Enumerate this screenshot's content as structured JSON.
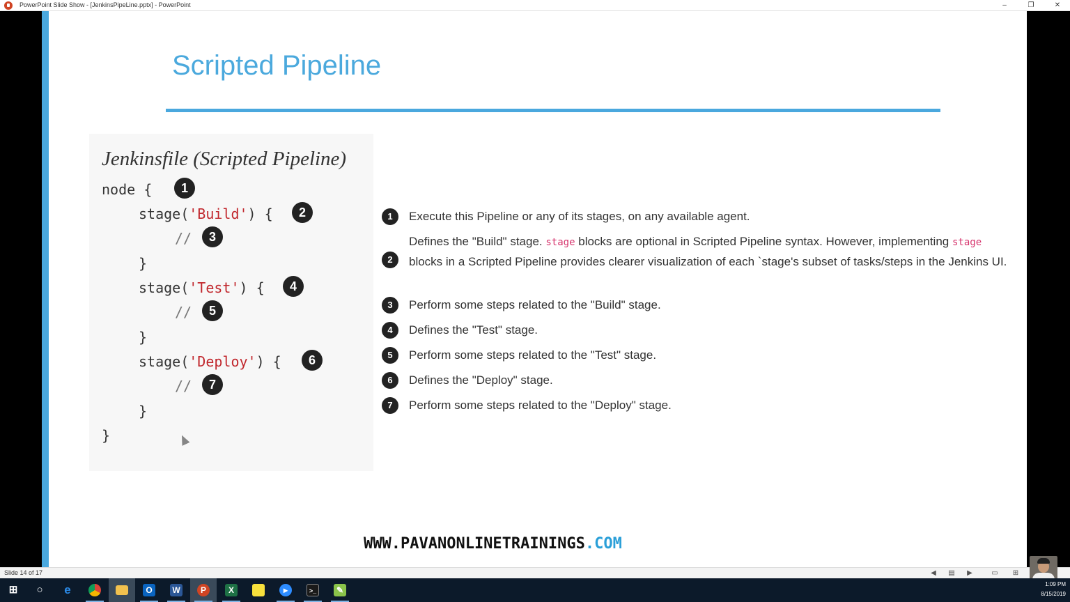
{
  "window": {
    "title": "PowerPoint Slide Show - [JenkinsPipeLine.pptx] - PowerPoint",
    "minimize": "–",
    "restore": "❐",
    "close": "✕"
  },
  "slide": {
    "title": "Scripted Pipeline",
    "code_title": "Jenkinsfile (Scripted Pipeline)",
    "code": {
      "node": "node {",
      "stage_open": "stage(",
      "stage_close": ") {",
      "build": "'Build'",
      "test": "'Test'",
      "deploy": "'Deploy'",
      "comment": "//",
      "close_brace": "}"
    },
    "badges": [
      "1",
      "2",
      "3",
      "4",
      "5",
      "6",
      "7"
    ],
    "annotations": {
      "a1": "Execute this Pipeline or any of its stages, on any available agent.",
      "a2_part1": "Defines the \"Build\" stage.",
      "a2_code1": "stage",
      "a2_part2": "blocks are optional in Scripted Pipeline syntax. However, implementing",
      "a2_code2": "stage",
      "a2_part3": "blocks in a Scripted Pipeline provides clearer visualization of each `stage's subset of tasks/steps in the Jenkins UI.",
      "a3": "Perform some steps related to the \"Build\" stage.",
      "a4": "Defines the \"Test\" stage.",
      "a5": "Perform some steps related to the \"Test\" stage.",
      "a6": "Defines the \"Deploy\" stage.",
      "a7": "Perform some steps related to the \"Deploy\" stage."
    },
    "website_main": "WWW.PAVANONLINETRAININGS",
    "website_suffix": ".COM"
  },
  "statusbar": {
    "slide_counter": "Slide 14 of 17"
  },
  "taskbar": {
    "clock_time": "1:09 PM",
    "clock_date": "8/15/2019",
    "apps": [
      "windows-start",
      "cortana-search",
      "edge",
      "chrome",
      "file-explorer",
      "outlook",
      "word",
      "powerpoint",
      "excel",
      "sticky-notes",
      "zoom",
      "command-prompt",
      "notepad-plus"
    ]
  },
  "colors": {
    "accent": "#4aa8de",
    "title": "#4ba9dd",
    "code_string": "#c1272d",
    "inline_code": "#d6336c",
    "website_com": "#2a9fd8"
  }
}
